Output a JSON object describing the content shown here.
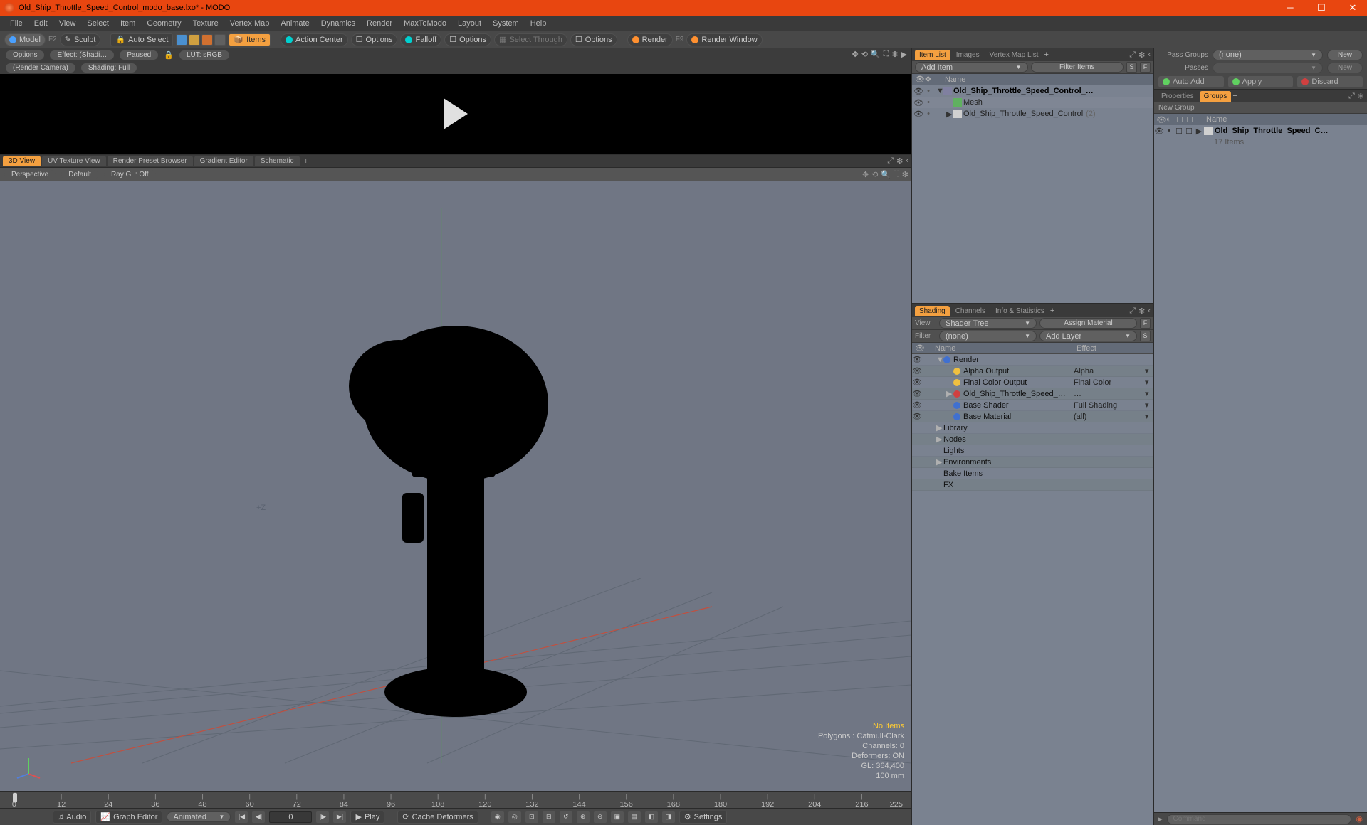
{
  "title": "Old_Ship_Throttle_Speed_Control_modo_base.lxo* - MODO",
  "menus": [
    "File",
    "Edit",
    "View",
    "Select",
    "Item",
    "Geometry",
    "Texture",
    "Vertex Map",
    "Animate",
    "Dynamics",
    "Render",
    "MaxToModo",
    "Layout",
    "System",
    "Help"
  ],
  "toolbar": {
    "model": "Model",
    "f2": "F2",
    "sculpt": "Sculpt",
    "autoselect": "Auto Select",
    "items": "Items",
    "actioncenter": "Action Center",
    "options1": "Options",
    "falloff": "Falloff",
    "options2": "Options",
    "selectthrough": "Select Through",
    "options3": "Options",
    "render": "Render",
    "f9": "F9",
    "renderwindow": "Render Window"
  },
  "renderpanel": {
    "options": "Options",
    "effect": "Effect: (Shadi…",
    "paused": "Paused",
    "lut": "LUT: sRGB",
    "camera": "(Render Camera)",
    "shading": "Shading: Full"
  },
  "vptabs": [
    "3D View",
    "UV Texture View",
    "Render Preset Browser",
    "Gradient Editor",
    "Schematic"
  ],
  "vpopts": {
    "persp": "Perspective",
    "default": "Default",
    "raygl": "Ray GL: Off"
  },
  "vp_info": {
    "noitems": "No Items",
    "polygons": "Polygons : Catmull-Clark",
    "channels": "Channels: 0",
    "deformers": "Deformers: ON",
    "gl": "GL: 364,400",
    "scale": "100 mm"
  },
  "timeline": {
    "ticks": [
      0,
      12,
      24,
      36,
      48,
      60,
      72,
      84,
      96,
      108,
      120,
      132,
      144,
      156,
      168,
      180,
      192,
      204,
      216
    ],
    "end": 225
  },
  "bottombar": {
    "audio": "Audio",
    "graph": "Graph Editor",
    "animated": "Animated",
    "frame": "0",
    "play": "Play",
    "cache": "Cache Deformers",
    "settings": "Settings"
  },
  "itemlist": {
    "tabs": [
      "Item List",
      "Images",
      "Vertex Map List"
    ],
    "additem": "Add Item",
    "filter": "Filter Items",
    "s": "S",
    "f": "F",
    "head_name": "Name",
    "rows": [
      {
        "indent": 0,
        "expand": "▼",
        "name": "Old_Ship_Throttle_Speed_Control_…",
        "bold": true,
        "icon": "#8080a0"
      },
      {
        "indent": 1,
        "expand": "",
        "name": "Mesh",
        "bold": false,
        "icon": "#60b060"
      },
      {
        "indent": 1,
        "expand": "▶",
        "name": "Old_Ship_Throttle_Speed_Control",
        "bold": false,
        "icon": "#d0d0d0",
        "count": "(2)"
      }
    ]
  },
  "shading": {
    "tabs": [
      "Shading",
      "Channels",
      "Info & Statistics"
    ],
    "view": "View",
    "shadertree": "Shader Tree",
    "assign": "Assign Material",
    "f": "F",
    "filter": "Filter",
    "none": "(none)",
    "addlayer": "Add Layer",
    "s": "S",
    "head_name": "Name",
    "head_effect": "Effect",
    "rows": [
      {
        "eye": true,
        "indent": 0,
        "exp": "▼",
        "swatch": "#4070d0",
        "name": "Render",
        "effect": ""
      },
      {
        "eye": true,
        "indent": 1,
        "exp": "",
        "swatch": "#f0c040",
        "name": "Alpha Output",
        "effect": "Alpha",
        "arrow": true
      },
      {
        "eye": true,
        "indent": 1,
        "exp": "",
        "swatch": "#f0c040",
        "name": "Final Color Output",
        "effect": "Final Color",
        "arrow": true
      },
      {
        "eye": true,
        "indent": 1,
        "exp": "▶",
        "swatch": "#d04040",
        "name": "Old_Ship_Throttle_Speed_…",
        "effect": "…",
        "arrow": true
      },
      {
        "eye": true,
        "indent": 1,
        "exp": "",
        "swatch": "#4070d0",
        "name": "Base Shader",
        "effect": "Full Shading",
        "arrow": true
      },
      {
        "eye": true,
        "indent": 1,
        "exp": "",
        "swatch": "#4070d0",
        "name": "Base Material",
        "effect": "(all)",
        "arrow": true
      },
      {
        "eye": false,
        "indent": 0,
        "exp": "▶",
        "swatch": "",
        "name": "Library",
        "effect": ""
      },
      {
        "eye": false,
        "indent": 0,
        "exp": "▶",
        "swatch": "",
        "name": "Nodes",
        "effect": ""
      },
      {
        "eye": false,
        "indent": 0,
        "exp": "",
        "swatch": "",
        "name": "Lights",
        "effect": ""
      },
      {
        "eye": false,
        "indent": 0,
        "exp": "▶",
        "swatch": "",
        "name": "Environments",
        "effect": ""
      },
      {
        "eye": false,
        "indent": 0,
        "exp": "",
        "swatch": "",
        "name": "Bake Items",
        "effect": ""
      },
      {
        "eye": false,
        "indent": 0,
        "exp": "",
        "swatch": "",
        "name": "FX",
        "effect": ""
      }
    ]
  },
  "passes": {
    "passgroups": "Pass Groups",
    "none": "(none)",
    "new": "New",
    "passeslbl": "Passes",
    "new2": "New",
    "autoadd": "Auto Add",
    "apply": "Apply",
    "discard": "Discard"
  },
  "groups": {
    "tab_props": "Properties",
    "tab_groups": "Groups",
    "newgroup": "New Group",
    "head_name": "Name",
    "row_name": "Old_Ship_Throttle_Speed_C…",
    "row_sub": "17 Items"
  },
  "command": {
    "placeholder": "Command"
  }
}
